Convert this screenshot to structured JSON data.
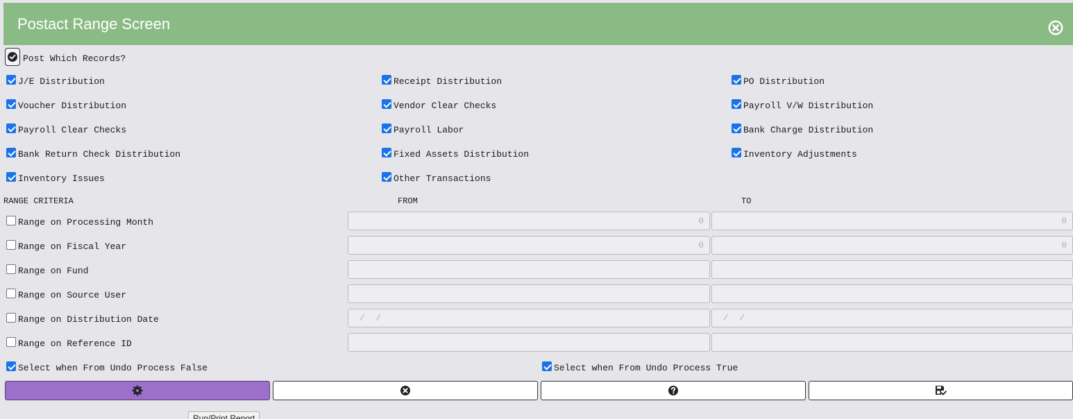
{
  "window": {
    "title": "Postact Range Screen",
    "close_icon": "close-circle-icon"
  },
  "post_which": {
    "label": "Post Which Records?",
    "checked": true
  },
  "records": [
    {
      "label": "J/E Distribution",
      "checked": true
    },
    {
      "label": "Receipt Distribution",
      "checked": true
    },
    {
      "label": "PO Distribution",
      "checked": true
    },
    {
      "label": "Voucher Distribution",
      "checked": true
    },
    {
      "label": "Vendor Clear Checks",
      "checked": true
    },
    {
      "label": "Payroll V/W Distribution",
      "checked": true
    },
    {
      "label": "Payroll Clear Checks",
      "checked": true
    },
    {
      "label": "Payroll Labor",
      "checked": true
    },
    {
      "label": "Bank Charge Distribution",
      "checked": true
    },
    {
      "label": "Bank Return Check Distribution",
      "checked": true
    },
    {
      "label": "Fixed Assets Distribution",
      "checked": true
    },
    {
      "label": "Inventory Adjustments",
      "checked": true
    },
    {
      "label": "Inventory Issues",
      "checked": true
    },
    {
      "label": "Other Transactions",
      "checked": true
    }
  ],
  "range": {
    "header": "RANGE CRITERIA",
    "from_header": "FROM",
    "to_header": "TO",
    "rows": [
      {
        "label": "Range on Processing Month",
        "checked": false,
        "from": "0",
        "to": "0",
        "align": "right"
      },
      {
        "label": "Range on Fiscal Year",
        "checked": false,
        "from": "0",
        "to": "0",
        "align": "right"
      },
      {
        "label": "Range on Fund",
        "checked": false,
        "from": "",
        "to": "",
        "align": "left"
      },
      {
        "label": "Range on Source User",
        "checked": false,
        "from": "",
        "to": "",
        "align": "left"
      },
      {
        "label": "Range on Distribution Date",
        "checked": false,
        "from": " /  /",
        "to": " /  /",
        "align": "left"
      },
      {
        "label": "Range on Reference ID",
        "checked": false,
        "from": "",
        "to": "",
        "align": "left"
      }
    ]
  },
  "undo": {
    "false_label": "Select when From Undo Process False",
    "false_checked": true,
    "true_label": "Select when From Undo Process True",
    "true_checked": true
  },
  "buttons": {
    "run_icon": "gear-icon",
    "cancel_icon": "close-circle-icon",
    "help_icon": "question-circle-icon",
    "save_icon": "save-check-icon"
  },
  "tooltip": {
    "text": "Run/Print Report"
  },
  "colors": {
    "header_bg": "#8bbb85",
    "primary_button": "#9b6fca",
    "checkbox_blue": "#1a73e8",
    "page_bg": "#e6e6ea"
  }
}
